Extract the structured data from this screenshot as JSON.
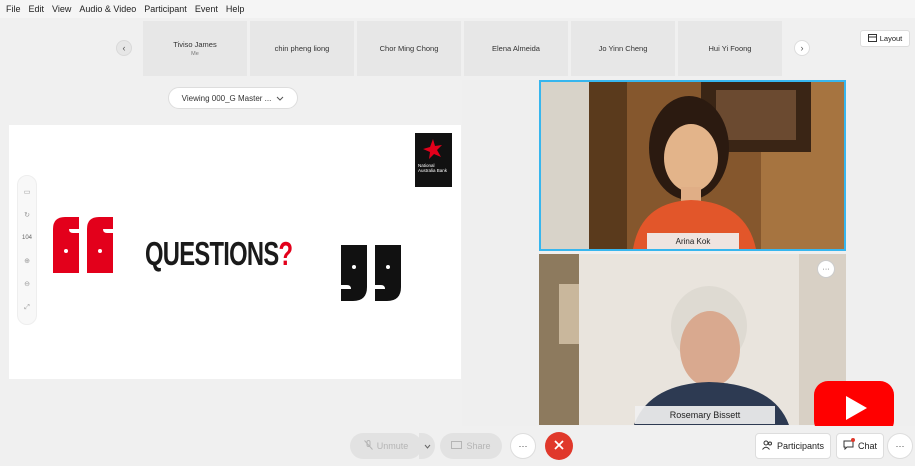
{
  "menu": [
    "File",
    "Edit",
    "View",
    "Audio & Video",
    "Participant",
    "Event",
    "Help"
  ],
  "strip": {
    "tiles": [
      {
        "name": "Tiviso James",
        "sub": "Me"
      },
      {
        "name": "chin pheng liong",
        "sub": ""
      },
      {
        "name": "Chor Ming Chong",
        "sub": ""
      },
      {
        "name": "Elena Almeida",
        "sub": ""
      },
      {
        "name": "Jo Yinn Cheng",
        "sub": ""
      },
      {
        "name": "Hui Yi Foong",
        "sub": ""
      }
    ],
    "prev_icon": "‹",
    "next_icon": "›",
    "layout_label": "Layout"
  },
  "share": {
    "viewing_label": "Viewing 000_G Master ...",
    "zoom_level": "104",
    "slide_title": "QUESTIONS",
    "slide_qmark": "?",
    "logo_text": "National Australia Bank",
    "brand_red": "#e3001b"
  },
  "videos": [
    {
      "name": "Arina Kok"
    },
    {
      "name": "Rosemary Bissett"
    }
  ],
  "video_more_icon": "···",
  "controls": {
    "unmute_label": "Unmute",
    "share_label": "Share",
    "more_label": "···",
    "participants_label": "Participants",
    "chat_label": "Chat",
    "end_color": "#e0382b",
    "accent": "#37b6ee",
    "youtube_red": "#ff0000"
  }
}
